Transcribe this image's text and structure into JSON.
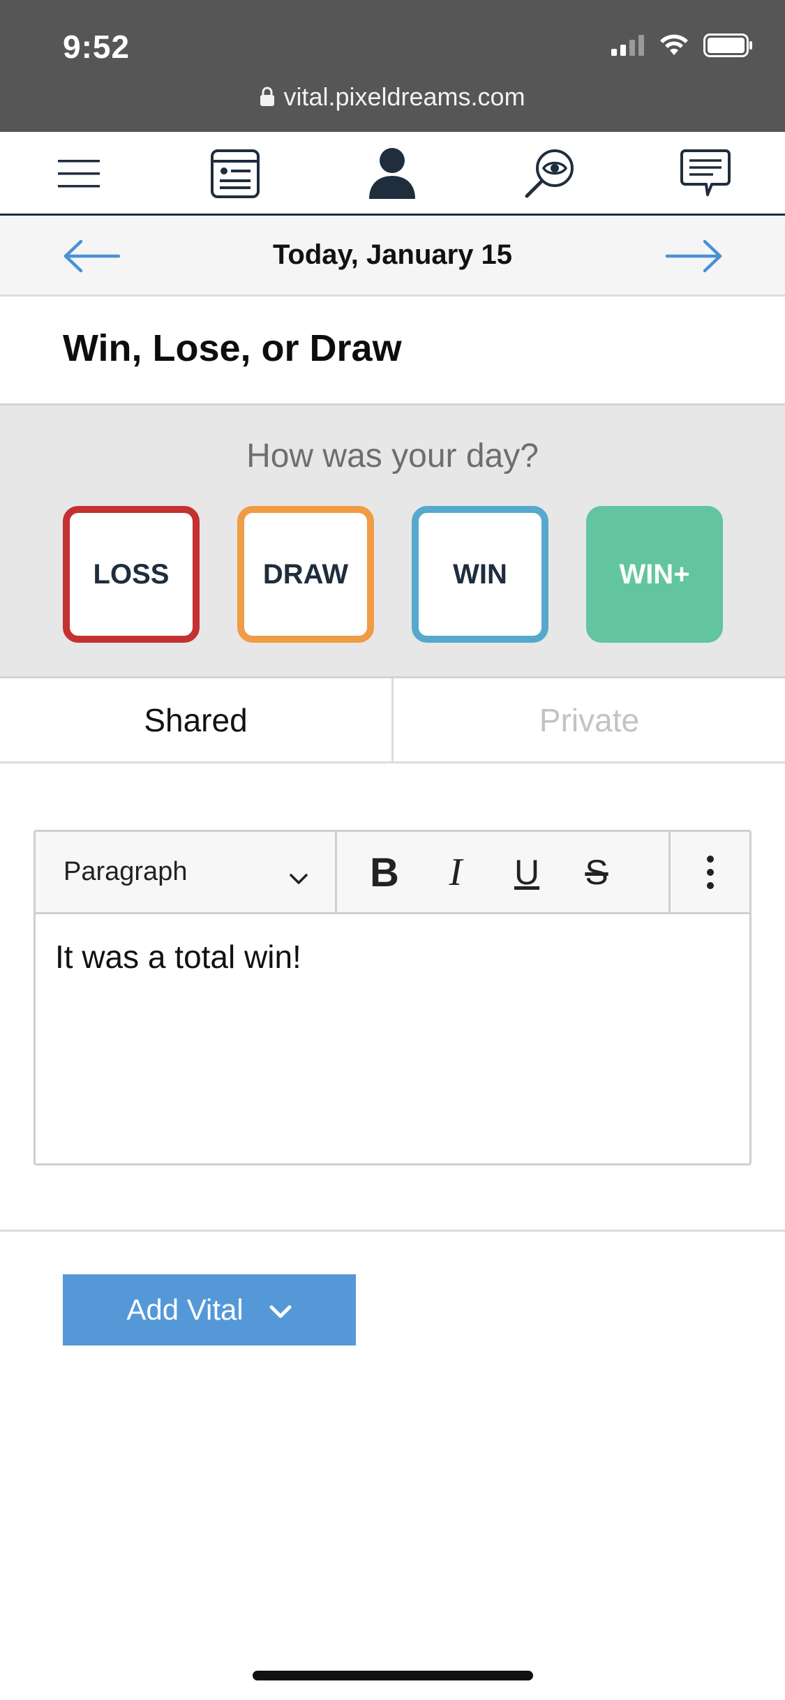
{
  "status_bar": {
    "time": "9:52",
    "url": "vital.pixeldreams.com",
    "icons": [
      "signal-icon",
      "wifi-icon",
      "battery-icon"
    ]
  },
  "nav": {
    "items": [
      {
        "name": "menu-icon"
      },
      {
        "name": "card-icon"
      },
      {
        "name": "profile-icon"
      },
      {
        "name": "search-eye-icon"
      },
      {
        "name": "messages-icon"
      }
    ]
  },
  "date_bar": {
    "title": "Today, January 15",
    "arrow_color": "#4a90d9"
  },
  "section": {
    "title": "Win, Lose, or Draw"
  },
  "rating": {
    "question": "How was your day?",
    "options": [
      {
        "label": "LOSS",
        "color": "#c53030"
      },
      {
        "label": "DRAW",
        "color": "#ef9c45"
      },
      {
        "label": "WIN",
        "color": "#56a9cc"
      },
      {
        "label": "WIN+",
        "color": "#62c5a0",
        "selected": true
      }
    ]
  },
  "tabs": {
    "shared": "Shared",
    "private": "Private",
    "active": "Shared"
  },
  "editor": {
    "block_format": "Paragraph",
    "bold_label": "B",
    "italic_label": "I",
    "underline_label": "U",
    "strike_label": "S",
    "content": "It was a total win!"
  },
  "add_button": {
    "label": "Add Vital",
    "color": "#5598d8"
  }
}
